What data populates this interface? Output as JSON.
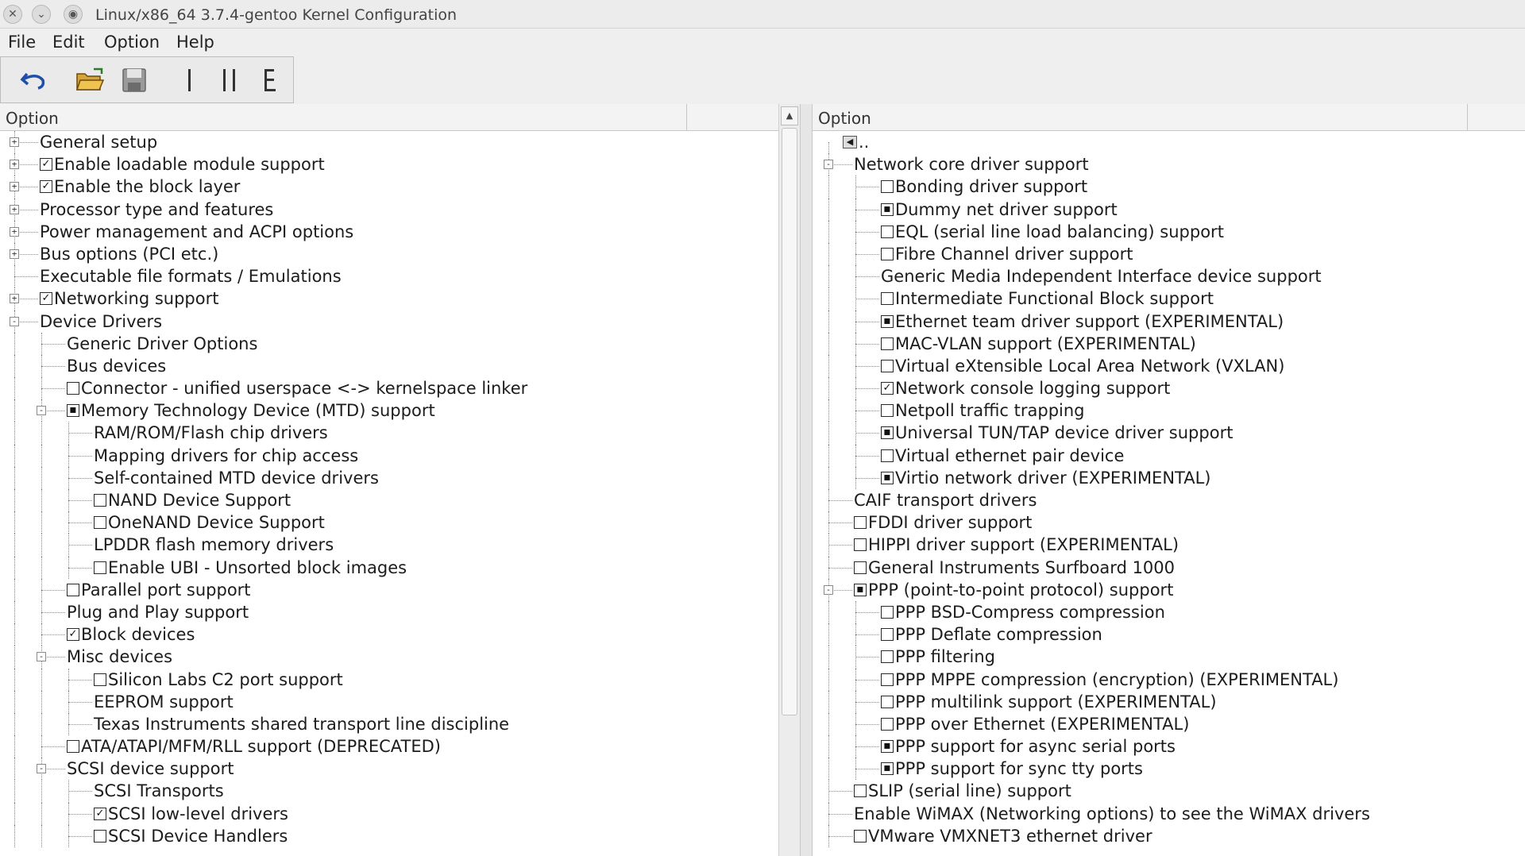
{
  "window": {
    "title": "Linux/x86_64 3.7.4-gentoo Kernel Configuration",
    "close_glyph": "✕",
    "minimize_glyph": "⌄",
    "menu_glyph": "◉"
  },
  "menu": [
    "File",
    "Edit",
    "Option",
    "Help"
  ],
  "toolbar": {
    "icons": [
      "undo-icon",
      "open-folder-icon",
      "save-icon",
      "single-view-icon",
      "split-view-icon",
      "full-view-icon"
    ]
  },
  "left_pane": {
    "header": "Option",
    "scroll_up_glyph": "▲",
    "rows": [
      {
        "d": 0,
        "exp": "+",
        "cb": "",
        "t": "General setup"
      },
      {
        "d": 0,
        "exp": "+",
        "cb": "y",
        "t": "Enable loadable module support"
      },
      {
        "d": 0,
        "exp": "+",
        "cb": "y",
        "t": "Enable the block layer"
      },
      {
        "d": 0,
        "exp": "+",
        "cb": "",
        "t": "Processor type and features"
      },
      {
        "d": 0,
        "exp": "+",
        "cb": "",
        "t": "Power management and ACPI options"
      },
      {
        "d": 0,
        "exp": "+",
        "cb": "",
        "t": "Bus options (PCI etc.)"
      },
      {
        "d": 0,
        "exp": "",
        "cb": "",
        "t": "Executable file formats / Emulations"
      },
      {
        "d": 0,
        "exp": "+",
        "cb": "y",
        "t": "Networking support"
      },
      {
        "d": 0,
        "exp": "-",
        "cb": "",
        "t": "Device Drivers"
      },
      {
        "d": 1,
        "exp": "",
        "cb": "",
        "t": "Generic Driver Options"
      },
      {
        "d": 1,
        "exp": "",
        "cb": "",
        "t": "Bus devices"
      },
      {
        "d": 1,
        "exp": "",
        "cb": "n",
        "t": "Connector - unified userspace <-> kernelspace linker"
      },
      {
        "d": 1,
        "exp": "-",
        "cb": "m",
        "t": "Memory Technology Device (MTD) support"
      },
      {
        "d": 2,
        "exp": "",
        "cb": "",
        "t": "RAM/ROM/Flash chip drivers"
      },
      {
        "d": 2,
        "exp": "",
        "cb": "",
        "t": "Mapping drivers for chip access"
      },
      {
        "d": 2,
        "exp": "",
        "cb": "",
        "t": "Self-contained MTD device drivers"
      },
      {
        "d": 2,
        "exp": "",
        "cb": "n",
        "t": "NAND Device Support"
      },
      {
        "d": 2,
        "exp": "",
        "cb": "n",
        "t": "OneNAND Device Support"
      },
      {
        "d": 2,
        "exp": "",
        "cb": "",
        "t": "LPDDR flash memory drivers"
      },
      {
        "d": 2,
        "exp": "",
        "cb": "n",
        "t": "Enable UBI - Unsorted block images"
      },
      {
        "d": 1,
        "exp": "",
        "cb": "n",
        "t": "Parallel port support"
      },
      {
        "d": 1,
        "exp": "",
        "cb": "",
        "t": "Plug and Play support"
      },
      {
        "d": 1,
        "exp": "",
        "cb": "y",
        "t": "Block devices"
      },
      {
        "d": 1,
        "exp": "-",
        "cb": "",
        "t": "Misc devices"
      },
      {
        "d": 2,
        "exp": "",
        "cb": "n",
        "t": "Silicon Labs C2 port support"
      },
      {
        "d": 2,
        "exp": "",
        "cb": "",
        "t": "EEPROM support"
      },
      {
        "d": 2,
        "exp": "",
        "cb": "",
        "t": "Texas Instruments shared transport line discipline"
      },
      {
        "d": 1,
        "exp": "",
        "cb": "n",
        "t": "ATA/ATAPI/MFM/RLL support (DEPRECATED)"
      },
      {
        "d": 1,
        "exp": "-",
        "cb": "",
        "t": "SCSI device support"
      },
      {
        "d": 2,
        "exp": "",
        "cb": "",
        "t": "SCSI Transports"
      },
      {
        "d": 2,
        "exp": "",
        "cb": "y",
        "t": "SCSI low-level drivers"
      },
      {
        "d": 2,
        "exp": "",
        "cb": "n",
        "t": "SCSI Device Handlers"
      }
    ]
  },
  "right_pane": {
    "header": "Option",
    "up_row_label": "..",
    "rows": [
      {
        "d": 0,
        "exp": "-",
        "cb": "",
        "t": "Network core driver support"
      },
      {
        "d": 1,
        "exp": "",
        "cb": "n",
        "t": "Bonding driver support"
      },
      {
        "d": 1,
        "exp": "",
        "cb": "m",
        "t": "Dummy net driver support"
      },
      {
        "d": 1,
        "exp": "",
        "cb": "n",
        "t": "EQL (serial line load balancing) support"
      },
      {
        "d": 1,
        "exp": "",
        "cb": "n",
        "t": "Fibre Channel driver support"
      },
      {
        "d": 1,
        "exp": "",
        "cb": "",
        "t": "Generic Media Independent Interface device support"
      },
      {
        "d": 1,
        "exp": "",
        "cb": "n",
        "t": "Intermediate Functional Block support"
      },
      {
        "d": 1,
        "exp": "",
        "cb": "m",
        "t": "Ethernet team driver support (EXPERIMENTAL)"
      },
      {
        "d": 1,
        "exp": "",
        "cb": "n",
        "t": "MAC-VLAN support (EXPERIMENTAL)"
      },
      {
        "d": 1,
        "exp": "",
        "cb": "n",
        "t": "Virtual eXtensible Local Area Network (VXLAN)"
      },
      {
        "d": 1,
        "exp": "",
        "cb": "y",
        "t": "Network console logging support"
      },
      {
        "d": 1,
        "exp": "",
        "cb": "n",
        "t": "Netpoll traffic trapping"
      },
      {
        "d": 1,
        "exp": "",
        "cb": "m",
        "t": "Universal TUN/TAP device driver support"
      },
      {
        "d": 1,
        "exp": "",
        "cb": "n",
        "t": "Virtual ethernet pair device"
      },
      {
        "d": 1,
        "exp": "",
        "cb": "m",
        "t": "Virtio network driver (EXPERIMENTAL)"
      },
      {
        "d": 0,
        "exp": "",
        "cb": "",
        "t": "CAIF transport drivers"
      },
      {
        "d": 0,
        "exp": "",
        "cb": "n",
        "t": "FDDI driver support"
      },
      {
        "d": 0,
        "exp": "",
        "cb": "n",
        "t": "HIPPI driver support (EXPERIMENTAL)"
      },
      {
        "d": 0,
        "exp": "",
        "cb": "n",
        "t": "General Instruments Surfboard 1000"
      },
      {
        "d": 0,
        "exp": "-",
        "cb": "m",
        "t": "PPP (point-to-point protocol) support"
      },
      {
        "d": 1,
        "exp": "",
        "cb": "n",
        "t": "PPP BSD-Compress compression"
      },
      {
        "d": 1,
        "exp": "",
        "cb": "n",
        "t": "PPP Deflate compression"
      },
      {
        "d": 1,
        "exp": "",
        "cb": "n",
        "t": "PPP filtering"
      },
      {
        "d": 1,
        "exp": "",
        "cb": "n",
        "t": "PPP MPPE compression (encryption) (EXPERIMENTAL)"
      },
      {
        "d": 1,
        "exp": "",
        "cb": "n",
        "t": "PPP multilink support (EXPERIMENTAL)"
      },
      {
        "d": 1,
        "exp": "",
        "cb": "n",
        "t": "PPP over Ethernet (EXPERIMENTAL)"
      },
      {
        "d": 1,
        "exp": "",
        "cb": "m",
        "t": "PPP support for async serial ports"
      },
      {
        "d": 1,
        "exp": "",
        "cb": "m",
        "t": "PPP support for sync tty ports"
      },
      {
        "d": 0,
        "exp": "",
        "cb": "n",
        "t": "SLIP (serial line) support"
      },
      {
        "d": 0,
        "exp": "",
        "cb": "",
        "t": "Enable WiMAX (Networking options) to see the WiMAX drivers"
      },
      {
        "d": 0,
        "exp": "",
        "cb": "n",
        "t": "VMware VMXNET3 ethernet driver"
      }
    ]
  }
}
